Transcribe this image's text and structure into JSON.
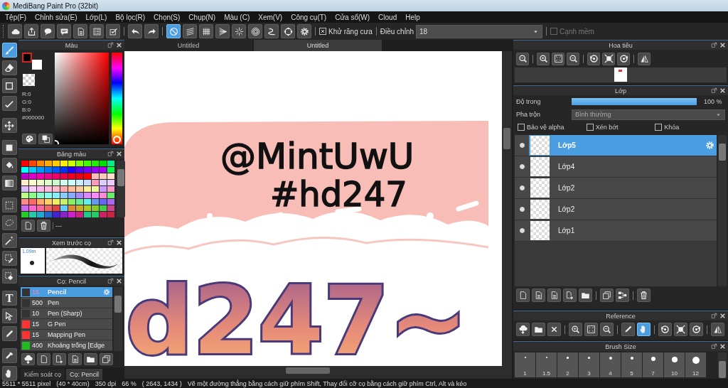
{
  "window": {
    "title": "MediBang Paint Pro (32bit)"
  },
  "menu": [
    "Tệp(F)",
    "Chỉnh sửa(E)",
    "Lớp(L)",
    "Bộ lọc(R)",
    "Chọn(S)",
    "Chụp(N)",
    "Màu (C)",
    "Xem(V)",
    "Công cụ(T)",
    "Cửa sổ(W)",
    "Cloud",
    "Help"
  ],
  "toolbar": {
    "snap_tools": [
      {
        "selected": true
      },
      {
        "selected": false
      },
      {
        "selected": false
      },
      {
        "selected": false
      },
      {
        "selected": false
      },
      {
        "selected": false
      },
      {
        "selected": false
      },
      {
        "selected": false
      },
      {
        "selected": false
      }
    ],
    "antialias": {
      "label": "Khử răng cưa",
      "checked": true
    },
    "correction": {
      "label": "Điều chỉnh",
      "value": "18"
    },
    "soft_edge": {
      "label": "Cạnh mềm",
      "checked": false,
      "disabled": true
    }
  },
  "tools": [
    {
      "selected": true
    },
    {
      "selected": false
    },
    {
      "selected": false
    },
    {
      "selected": false
    },
    {
      "selected": false
    },
    {
      "selected": false
    },
    {
      "selected": false
    },
    {
      "selected": false
    },
    {
      "selected": false
    },
    {
      "selected": false
    },
    {
      "selected": false
    },
    {
      "selected": false
    },
    {
      "selected": false
    },
    {
      "selected": false,
      "glyph": "T"
    },
    {
      "selected": false
    },
    {
      "selected": false
    },
    {
      "selected": false
    },
    {
      "selected": false
    }
  ],
  "color_panel": {
    "title": "Màu",
    "hue": {
      "level": 0
    },
    "r": "R:0",
    "g": "G:0",
    "b": "B:0",
    "hex": "#000000"
  },
  "palette_panel": {
    "title": "Bảng màu",
    "swatches": [
      {
        "color": "#ff0000"
      },
      {
        "color": "#ff4400"
      },
      {
        "color": "#ff8800"
      },
      {
        "color": "#ffaa00"
      },
      {
        "color": "#ffcc00"
      },
      {
        "color": "#ffee00"
      },
      {
        "color": "#ccff00"
      },
      {
        "color": "#88ff00"
      },
      {
        "color": "#44ff00"
      },
      {
        "color": "#22ee00"
      },
      {
        "color": "#00dd00"
      },
      {
        "color": "#00ee88"
      },
      {
        "color": "#00ffff"
      },
      {
        "color": "#00ccff"
      },
      {
        "color": "#0099ff"
      },
      {
        "color": "#0077ff"
      },
      {
        "color": "#0055ff"
      },
      {
        "color": "#0033ff"
      },
      {
        "color": "#2200ff"
      },
      {
        "color": "#5500ff"
      },
      {
        "color": "#7700ff"
      },
      {
        "color": "#9900ff"
      },
      {
        "color": "#aa00ee"
      },
      {
        "color": "#00ff44"
      },
      {
        "color": "#bb00cc"
      },
      {
        "color": "#dd00cc"
      },
      {
        "color": "#ee00aa"
      },
      {
        "color": "#ee0088"
      },
      {
        "color": "#ee0066"
      },
      {
        "color": "#ee0044"
      },
      {
        "color": "#ee0022"
      },
      {
        "color": "#ee0011"
      },
      {
        "color": "#ff0000"
      },
      {
        "color": "#ffbbbb"
      },
      {
        "color": "#ffccbb"
      },
      {
        "color": "#ffddcc"
      },
      {
        "color": "#ffeecc"
      },
      {
        "color": "#ffffcc"
      },
      {
        "color": "#eeffcc"
      },
      {
        "color": "#ddffcc"
      },
      {
        "color": "#ccffcc"
      },
      {
        "color": "#ccffee"
      },
      {
        "color": "#ccffff"
      },
      {
        "color": "#cceeff"
      },
      {
        "color": "#ccddff"
      },
      {
        "color": "#ff99bb"
      },
      {
        "color": "#ddccff"
      },
      {
        "color": "#eeccff"
      },
      {
        "color": "#ddbbff"
      },
      {
        "color": "#ffccff"
      },
      {
        "color": "#ffbbee"
      },
      {
        "color": "#ffbbdd"
      },
      {
        "color": "#ffbbcc"
      },
      {
        "color": "#ffaaaa"
      },
      {
        "color": "#ffbb99"
      },
      {
        "color": "#ffcc99"
      },
      {
        "color": "#ffee99"
      },
      {
        "color": "#eeff99"
      },
      {
        "color": "#cc99ff"
      },
      {
        "color": "#ff99cc"
      },
      {
        "color": "#bbff88"
      },
      {
        "color": "#88ff88"
      },
      {
        "color": "#88ffcc"
      },
      {
        "color": "#88ffee"
      },
      {
        "color": "#88eeff"
      },
      {
        "color": "#88ccff"
      },
      {
        "color": "#88aaff"
      },
      {
        "color": "#aa88ff"
      },
      {
        "color": "#dd88ff"
      },
      {
        "color": "#ff88ff"
      },
      {
        "color": "#ff88dd"
      },
      {
        "color": "#66ee66"
      },
      {
        "color": "#ff8888"
      },
      {
        "color": "#ff6666"
      },
      {
        "color": "#ffaa66"
      },
      {
        "color": "#ffcc66"
      },
      {
        "color": "#eeee66"
      },
      {
        "color": "#ccee66"
      },
      {
        "color": "#88ee66"
      },
      {
        "color": "#66ee99"
      },
      {
        "color": "#66eeee"
      },
      {
        "color": "#6699ee"
      },
      {
        "color": "#6666ee"
      },
      {
        "color": "#aa66ee"
      },
      {
        "color": "#cc66ee"
      },
      {
        "color": "#ff66cc"
      },
      {
        "color": "#ff6699"
      },
      {
        "color": "#ee6666"
      },
      {
        "color": "#dd4444"
      },
      {
        "color": "#66ccff"
      },
      {
        "color": "#dd8833"
      },
      {
        "color": "#ccaa22"
      },
      {
        "color": "#aacc22"
      },
      {
        "color": "#88cc22"
      },
      {
        "color": "#44cc44"
      },
      {
        "color": "#cc4488"
      },
      {
        "color": "#22cc22"
      },
      {
        "color": "#22ccaa"
      },
      {
        "color": "#22aacc"
      },
      {
        "color": "#2266cc"
      },
      {
        "color": "#4422cc"
      },
      {
        "color": "#8822cc"
      },
      {
        "color": "#cc22cc"
      },
      {
        "color": "#cc2288"
      },
      {
        "color": "#22cc88"
      },
      {
        "color": "#22cc66"
      },
      {
        "color": "#cc2266"
      },
      {
        "color": "#cc2244"
      }
    ],
    "footer": "---"
  },
  "brush_preview": {
    "title": "Xem trước cọ",
    "size": "1.09m"
  },
  "brush_panel": {
    "title": "Cọ: Pencil",
    "brushes": [
      {
        "size": "15",
        "name": "Pencil",
        "color": "#333333",
        "selected": true
      },
      {
        "size": "500",
        "name": "Pen",
        "color": "#333333",
        "selected": false
      },
      {
        "size": "10",
        "name": "Pen (Sharp)",
        "color": "#333333",
        "selected": false
      },
      {
        "size": "15",
        "name": "G Pen",
        "color": "#ff3333",
        "selected": false
      },
      {
        "size": "15",
        "name": "Mapping Pen",
        "color": "#ff3333",
        "selected": false
      },
      {
        "size": "400",
        "name": "Khoảng trống [Edge",
        "color": "#22bb22",
        "selected": false
      }
    ],
    "tabs": [
      {
        "label": "Kiểm soát cọ",
        "selected": false
      },
      {
        "label": "Cọ: Pencil",
        "selected": true
      }
    ]
  },
  "document_tabs": [
    {
      "label": "Untitled",
      "selected": false
    },
    {
      "label": "Untitled",
      "selected": true
    }
  ],
  "canvas": {
    "texts": [
      "@MintUwU",
      "#hd247",
      "d247~"
    ]
  },
  "navigator": {
    "title": "Hoa tiêu"
  },
  "layer_panel": {
    "title": "Lớp",
    "opacity": {
      "label": "Độ trong",
      "level": 1,
      "reading": "100 %"
    },
    "blend": {
      "label": "Pha trộn",
      "value": "Bình thường"
    },
    "options": [
      {
        "label": "Bảo vệ alpha",
        "checked": false
      },
      {
        "label": "Xén bớt",
        "checked": false
      },
      {
        "label": "Khóa",
        "checked": false
      }
    ],
    "layers": [
      {
        "name": "Lớp5",
        "visible": true,
        "selected": true
      },
      {
        "name": "Lớp4",
        "visible": true,
        "selected": false
      },
      {
        "name": "Lớp2",
        "visible": true,
        "selected": false
      },
      {
        "name": "Lớp2",
        "visible": true,
        "selected": false
      },
      {
        "name": "Lớp1",
        "visible": true,
        "selected": false
      }
    ]
  },
  "reference_panel": {
    "title": "Reference",
    "tools": [
      {
        "selected": false
      },
      {
        "selected": false
      },
      {
        "selected": false
      },
      {
        "selected": false
      },
      {
        "selected": false
      },
      {
        "selected": false
      },
      {
        "selected": false
      },
      {
        "selected": true
      },
      {
        "selected": false
      },
      {
        "selected": false
      },
      {
        "selected": false
      },
      {
        "selected": false
      }
    ]
  },
  "brush_size_panel": {
    "title": "Brush Size",
    "sizes": [
      "1",
      "1.5",
      "2",
      "3",
      "4",
      "5",
      "7",
      "10",
      "12"
    ]
  },
  "status_bar": {
    "dimensions": "5511 * 5511 pixel",
    "physical_size": "(40 * 40cm)",
    "resolution": "350 dpi",
    "zoom": "66 %",
    "cursor": "( 2643, 1434 )",
    "hint": "Vẽ một đường thẳng bằng cách giữ phím Shift, Thay đổi cỡ cọ bằng cách giữ phím Ctrl, Alt và kéo"
  }
}
